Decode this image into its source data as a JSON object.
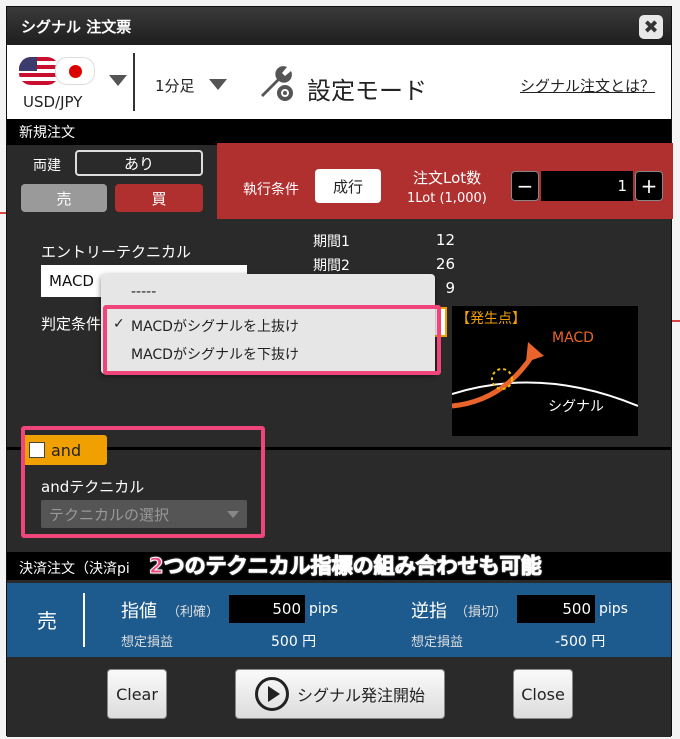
{
  "window": {
    "title": "シグナル 注文票",
    "close_glyph": "✖"
  },
  "topbar": {
    "currency_pair": "USD/JPY",
    "timeframe": "1分足",
    "mode_label": "設定モード",
    "help_link": "シグナル注文とは？"
  },
  "new_order": {
    "section_title": "新規注文",
    "hedge_label": "両建",
    "hedge_value": "あり",
    "sell_label": "売",
    "buy_label": "買",
    "exec_condition_label": "執行条件",
    "exec_condition_value": "成行",
    "lot_label": "注文Lot数",
    "lot_sublabel": "1Lot (1,000)",
    "lot_value": "1",
    "minus": "−",
    "plus": "+"
  },
  "entry": {
    "technical_label": "エントリーテクニカル",
    "technical_value": "MACD",
    "judge_label": "判定条件",
    "params": [
      {
        "name": "期間1",
        "value": "12"
      },
      {
        "name": "期間2",
        "value": "26"
      },
      {
        "name": "",
        "value": "9"
      }
    ],
    "dropdown": {
      "options": [
        "-----",
        "MACDがシグナルを上抜け",
        "MACDがシグナルを下抜け"
      ],
      "checkmark": "✓"
    },
    "chart_image": {
      "tag": "【発生点】",
      "macd_label": "MACD",
      "signal_label": "シグナル"
    }
  },
  "and_section": {
    "checkbox_label": "and",
    "technical_label": "andテクニカル",
    "technical_placeholder": "テクニカルの選択"
  },
  "settlement": {
    "section_title": "決済注文（決済pi",
    "annotation": "2つのテクニカル指標の組み合わせも可能",
    "side_label": "売",
    "limit_label": "指値",
    "limit_sub": "（利確）",
    "limit_value": "500",
    "limit_unit": "pips",
    "limit_pl_label": "想定損益",
    "limit_pl_value": "500 円",
    "stop_label": "逆指",
    "stop_sub": "（損切）",
    "stop_value": "500",
    "stop_unit": "pips",
    "stop_pl_label": "想定損益",
    "stop_pl_value": "-500 円"
  },
  "buttons": {
    "clear": "Clear",
    "start": "シグナル発注開始",
    "close": "Close"
  },
  "colors": {
    "accent_red": "#b0302f",
    "highlight_pink": "#f0457a",
    "and_orange": "#f0a000",
    "panel_blue": "#1d5a8e"
  }
}
